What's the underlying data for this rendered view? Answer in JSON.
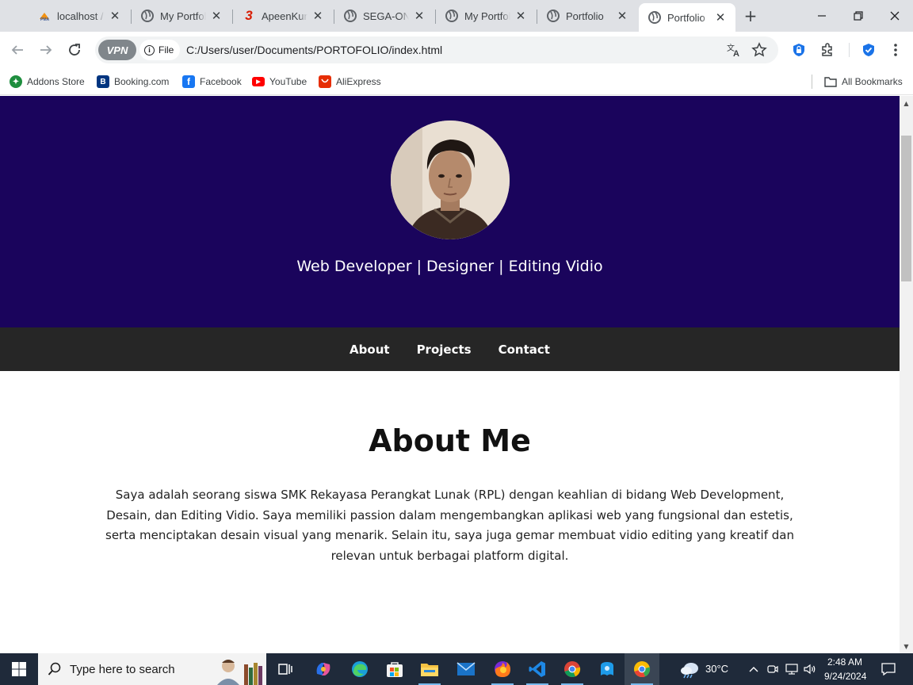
{
  "browser": {
    "tabs": [
      {
        "title": "localhost /",
        "favicon": "phpmyadmin-icon",
        "active": false
      },
      {
        "title": "My Portfolio",
        "favicon": "globe-icon",
        "active": false
      },
      {
        "title": "ApeenKun",
        "favicon": "three-logo-icon",
        "active": false
      },
      {
        "title": "SEGA-ONE",
        "favicon": "globe-icon",
        "active": false
      },
      {
        "title": "My Portfolio",
        "favicon": "globe-icon",
        "active": false
      },
      {
        "title": "Portfolio",
        "favicon": "globe-icon",
        "active": false
      },
      {
        "title": "Portfolio",
        "favicon": "globe-icon",
        "active": true
      }
    ],
    "omnibox": {
      "vpn_label": "VPN",
      "file_chip": "File",
      "url": "C:/Users/user/Documents/PORTOFOLIO/index.html"
    },
    "bookmarks": [
      {
        "label": "Addons Store",
        "icon": "addons-store-icon",
        "color": "#1e8e3e"
      },
      {
        "label": "Booking.com",
        "icon": "booking-icon",
        "color": "#003580"
      },
      {
        "label": "Facebook",
        "icon": "facebook-icon",
        "color": "#1877f2"
      },
      {
        "label": "YouTube",
        "icon": "youtube-icon",
        "color": "#ff0000"
      },
      {
        "label": "AliExpress",
        "icon": "aliexpress-icon",
        "color": "#e62e04"
      }
    ],
    "all_bookmarks": "All Bookmarks"
  },
  "page": {
    "hero_color": "#1a045c",
    "tagline": "Web Developer | Designer | Editing Vidio",
    "nav": [
      "About",
      "Projects",
      "Contact"
    ],
    "about": {
      "title": "About Me",
      "text": "Saya adalah seorang siswa SMK Rekayasa Perangkat Lunak (RPL) dengan keahlian di bidang Web Development, Desain, dan Editing Vidio. Saya memiliki passion dalam mengembangkan aplikasi web yang fungsional dan estetis, serta menciptakan desain visual yang menarik. Selain itu, saya juga gemar membuat vidio editing yang kreatif dan relevan untuk berbagai platform digital."
    }
  },
  "taskbar": {
    "search_placeholder": "Type here to search",
    "weather": "30°C",
    "time": "2:48 AM",
    "date": "9/24/2024"
  }
}
